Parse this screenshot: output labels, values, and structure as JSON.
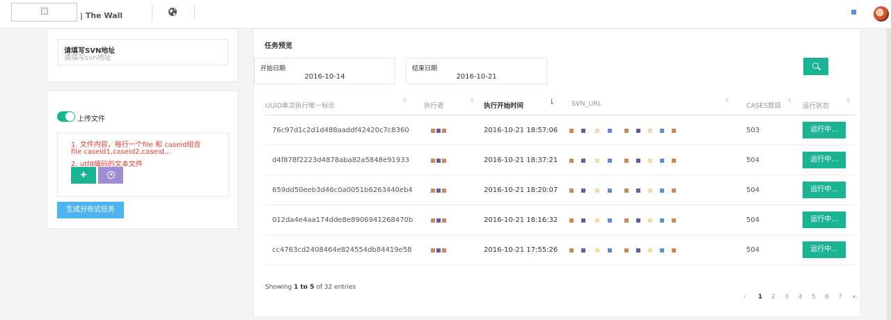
{
  "header": {
    "brand": "| The Wall",
    "globe_icon": "globe-icon"
  },
  "svn": {
    "label": "请填写SVN地址",
    "placeholder": "请填写svn地址"
  },
  "upload": {
    "toggle_label": "上传文件",
    "notes": [
      "1. 文件内容，每行一个file 和 caseid组合",
      "file caseid1,caseid2,caseid...",
      "2. utf8编码的文本文件"
    ],
    "plus_label": "+",
    "generate_label": "生成分布式任务"
  },
  "main": {
    "title": "任务预览",
    "start_date_label": "开始日期",
    "start_date_value": "2016-10-14",
    "end_date_label": "结束日期",
    "end_date_value": "2016-10-21",
    "columns": [
      "UUID单次执行唯一标示",
      "执行者",
      "执行开始时间",
      "SVN_URL",
      "CASES数目",
      "运行状态"
    ],
    "rows": [
      {
        "uuid": "76c97d1c2d1d488aaddf42420c7c8360",
        "time": "2016-10-21 18:57:06",
        "cases": "503",
        "status": "运行中..."
      },
      {
        "uuid": "d4f878f2223d4878aba82a5848e91933",
        "time": "2016-10-21 18:37:21",
        "cases": "504",
        "status": "运行中..."
      },
      {
        "uuid": "659dd50eeb3d46c0a0051b6263440eb4",
        "time": "2016-10-21 18:20:07",
        "cases": "504",
        "status": "运行中..."
      },
      {
        "uuid": "012da4e4aa174dde8e8906941268470b",
        "time": "2016-10-21 18:16:32",
        "cases": "504",
        "status": "运行中..."
      },
      {
        "uuid": "cc4763cd2408464e824554db84419e58",
        "time": "2016-10-21 17:55:26",
        "cases": "504",
        "status": "运行中..."
      }
    ],
    "footer": {
      "prefix": "Showing ",
      "range": "1 to 5",
      "suffix": " of 32 entries"
    },
    "pagination": [
      "‹",
      "1",
      "2",
      "3",
      "4",
      "5",
      "6",
      "7",
      "›"
    ],
    "current_page": "1"
  },
  "colors": {
    "accent": "#1ab394",
    "upload_button": "#9f8ed6",
    "generate_button": "#4db4f0",
    "note_text": "#e83a2e",
    "redaction_1": "#c8885a",
    "redaction_2": "#6a5a9a",
    "redaction_3": "#f7d9a8",
    "redaction_4": "#5a8fd0"
  }
}
